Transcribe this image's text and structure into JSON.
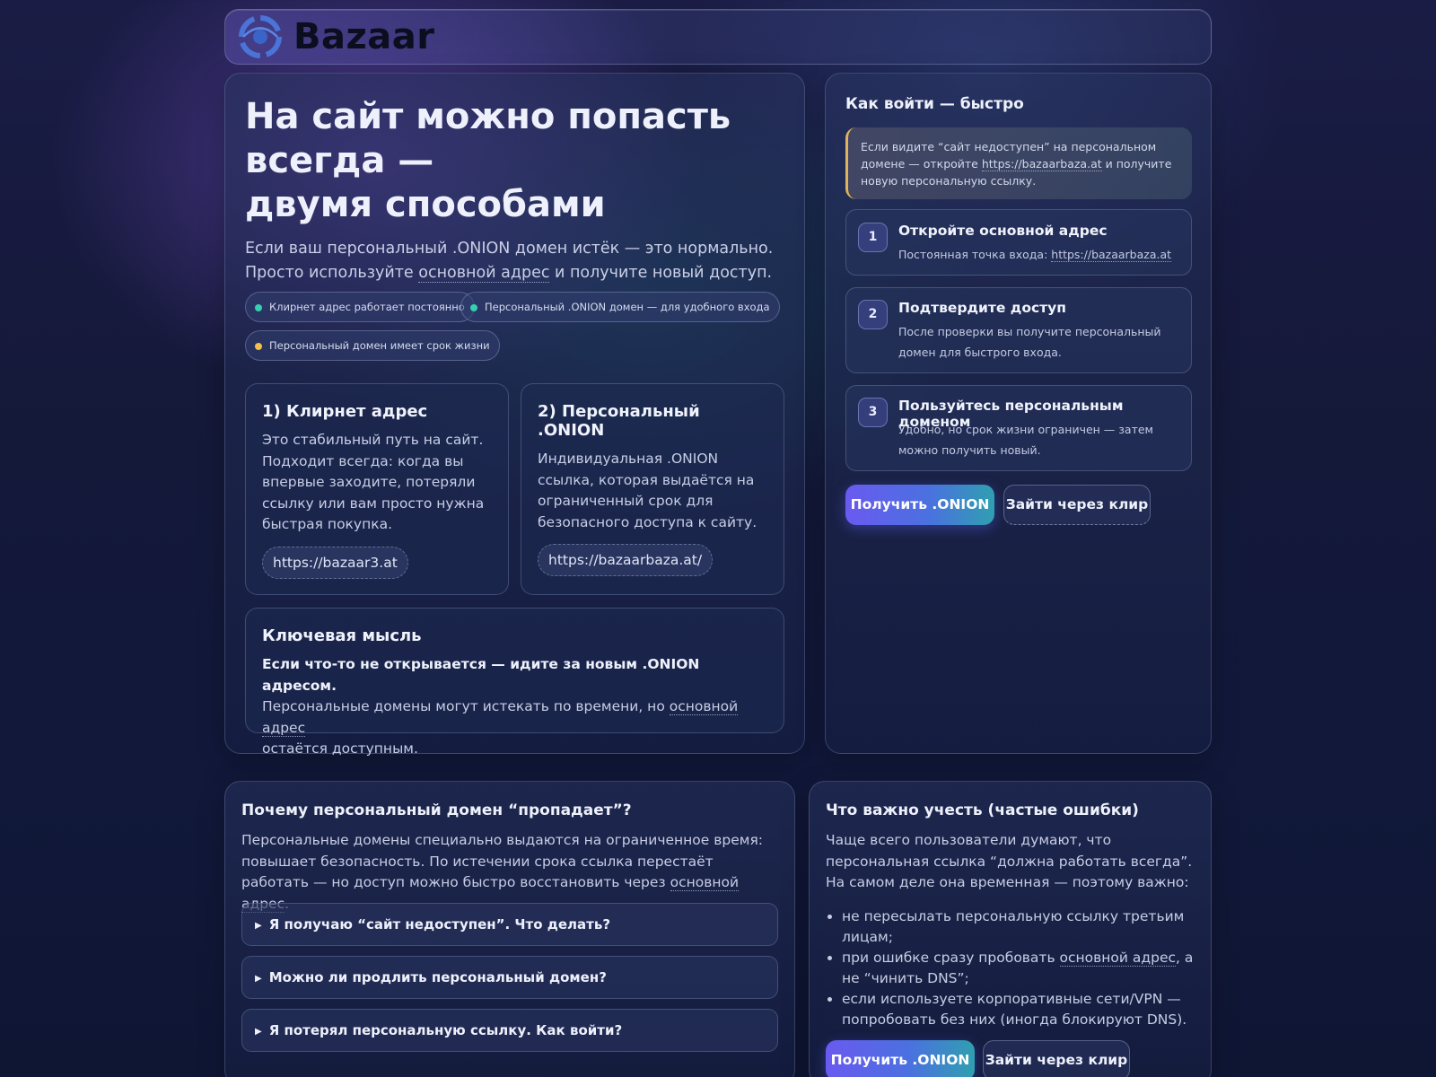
{
  "brand": {
    "name": "Bazaar",
    "logo_icon": "eye-logo-icon"
  },
  "hero": {
    "title_line1": "На сайт можно попасть",
    "title_line2": "всегда —",
    "title_line3": "двумя способами",
    "lead_part1": "Если ваш персональный .ONION домен истёк — это нормально.",
    "lead_part2": "Просто используйте ",
    "lead_link": "основной адрес",
    "lead_part3": " и получите новый доступ.",
    "chips": [
      {
        "label": "Клирнет адрес работает постоянно",
        "color": "#34d1b0"
      },
      {
        "label": "Персональный .ONION домен — для удобного входа",
        "color": "#34d1b0"
      },
      {
        "label": "Персональный домен имеет срок жизни",
        "color": "#f0c04a"
      }
    ],
    "card1": {
      "title": "1) Клирнет адрес",
      "text": "Это стабильный путь на сайт. Подходит всегда: когда вы впервые заходите, потеряли ссылку или вам просто нужна быстрая покупка.",
      "link": "https://bazaar3.at"
    },
    "card2": {
      "title": "2) Персональный .ONION",
      "text": "Индивидуальная .ONION ссылка, которая выдаётся на ограниченный срок для безопасного доступа к сайту.",
      "link": "https://bazaarbaza.at/"
    },
    "key": {
      "title": "Ключевая мысль",
      "bold": "Если что-то не открывается — идите за новым .ONION адресом.",
      "text1": "Персональные домены могут истекать по времени, но ",
      "link": "основной адрес",
      "text2": "остаётся доступным."
    }
  },
  "side": {
    "title": "Как войти — быстро",
    "warn_part1": "Если видите “сайт недоступен” на персональном домене — откройте ",
    "warn_link": "https://bazaarbaza.at",
    "warn_part2": " и получите новую персональную ссылку.",
    "steps": [
      {
        "num": "1",
        "title": "Откройте основной адрес",
        "desc": "Постоянная точка входа: ",
        "link": "https://bazaarbaza.at"
      },
      {
        "num": "2",
        "title": "Подтвердите доступ",
        "desc": "После проверки вы получите персональный домен для быстрого входа."
      },
      {
        "num": "3",
        "title": "Пользуйтесь персональным доменом",
        "desc": "Удобно, но срок жизни ограничен — затем можно получить новый."
      }
    ],
    "btn_primary": "Получить .ONION",
    "btn_secondary": "Зайти через клир"
  },
  "why": {
    "title": "Почему персональный домен “пропадает”?",
    "text1": "Персональные домены специально выдаются на ограниченное время: повышает безопасность. По истечении срока ссылка перестаёт работать — но доступ можно быстро восстановить через ",
    "link": "основной адрес",
    "text2": ".",
    "faq": [
      "Я получаю “сайт недоступен”. Что делать?",
      "Можно ли продлить персональный домен?",
      "Я потерял персональную ссылку. Как войти?"
    ]
  },
  "note": {
    "title": "Что важно учесть (частые ошибки)",
    "text": "Чаще всего пользователи думают, что персональная ссылка “должна работать всегда”. На самом деле она временная — поэтому важно:",
    "items": {
      "i1": "не пересылать персональную ссылку третьим лицам;",
      "i2a": "при ошибке сразу пробовать ",
      "i2link": "основной адрес",
      "i2b": ", а не “чинить DNS”;",
      "i3": "если используете корпоративные сети/VPN — попробовать без них (иногда блокируют DNS)."
    },
    "btn_primary": "Получить .ONION",
    "btn_secondary": "Зайти через клир"
  }
}
